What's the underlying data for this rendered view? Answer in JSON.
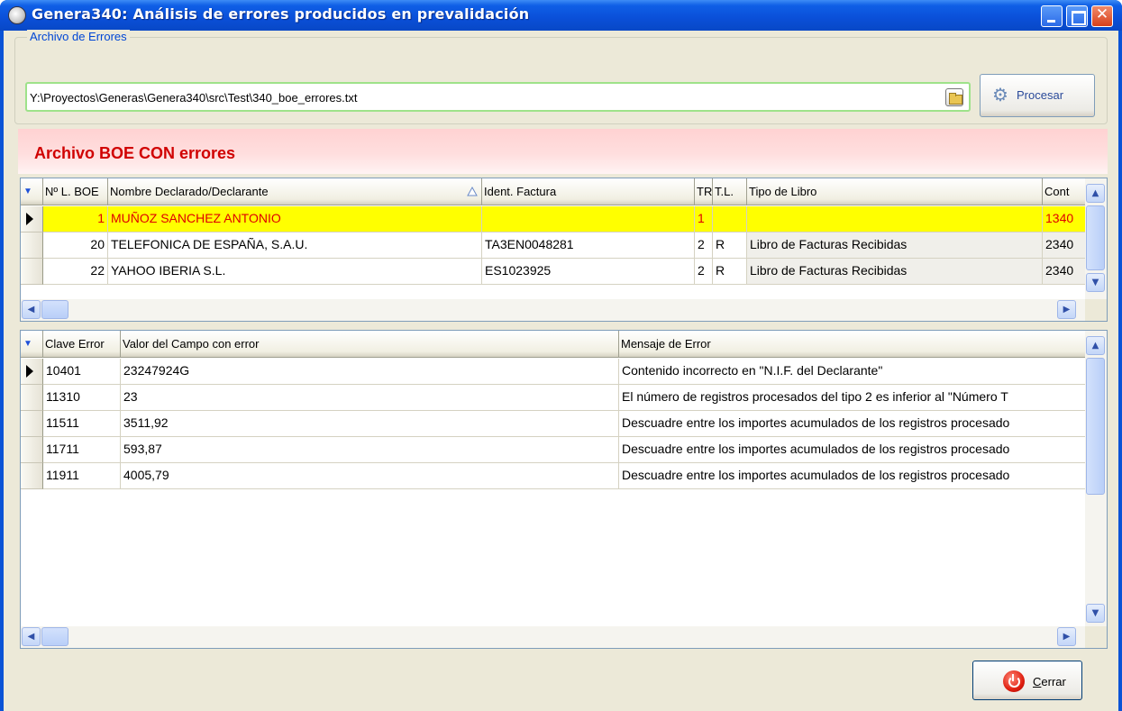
{
  "window": {
    "title": "Genera340: Análisis de errores producidos en prevalidación"
  },
  "file_group": {
    "legend": "Archivo de Errores",
    "path": "Y:\\Proyectos\\Generas\\Genera340\\src\\Test\\340_boe_errores.txt",
    "process_label": "Procesar"
  },
  "status": {
    "banner": "Archivo BOE CON errores",
    "banner_color": "#d00000"
  },
  "records_grid": {
    "columns": [
      "Nº L. BOE",
      "Nombre Declarado/Declarante",
      "Ident. Factura",
      "TR",
      "T.L.",
      "Tipo de Libro",
      "Cont"
    ],
    "rows": [
      {
        "num": "1",
        "name": "MUÑOZ SANCHEZ ANTONIO",
        "ident": "",
        "tr": "1",
        "tl": "",
        "tipo": "",
        "cont": "1340",
        "selected": true
      },
      {
        "num": "20",
        "name": "TELEFONICA DE ESPAÑA, S.A.U.",
        "ident": "TA3EN0048281",
        "tr": "2",
        "tl": "R",
        "tipo": "Libro de Facturas Recibidas",
        "cont": "2340",
        "selected": false
      },
      {
        "num": "22",
        "name": "YAHOO IBERIA S.L.",
        "ident": "ES1023925",
        "tr": "2",
        "tl": "R",
        "tipo": "Libro de Facturas Recibidas",
        "cont": "2340",
        "selected": false
      }
    ]
  },
  "errors_grid": {
    "columns": [
      "Clave Error",
      "Valor del Campo con error",
      "Mensaje de Error"
    ],
    "rows": [
      {
        "clave": "10401",
        "valor": "23247924G",
        "mensaje": "Contenido incorrecto en \"N.I.F. del Declarante\""
      },
      {
        "clave": "11310",
        "valor": "23",
        "mensaje": "El número de registros procesados del tipo 2 es inferior al \"Número T"
      },
      {
        "clave": "11511",
        "valor": "3511,92",
        "mensaje": "Descuadre entre los importes acumulados de los registros procesado"
      },
      {
        "clave": "11711",
        "valor": "593,87",
        "mensaje": "Descuadre entre los importes acumulados de los registros procesado"
      },
      {
        "clave": "11911",
        "valor": "4005,79",
        "mensaje": "Descuadre entre los importes acumulados de los registros procesado"
      }
    ]
  },
  "footer": {
    "close_label_u": "C",
    "close_label_rest": "errar"
  },
  "icons": {
    "app": "app-icon",
    "folder": "folder-open-icon",
    "process": "gears-icon",
    "close": "power-icon"
  }
}
